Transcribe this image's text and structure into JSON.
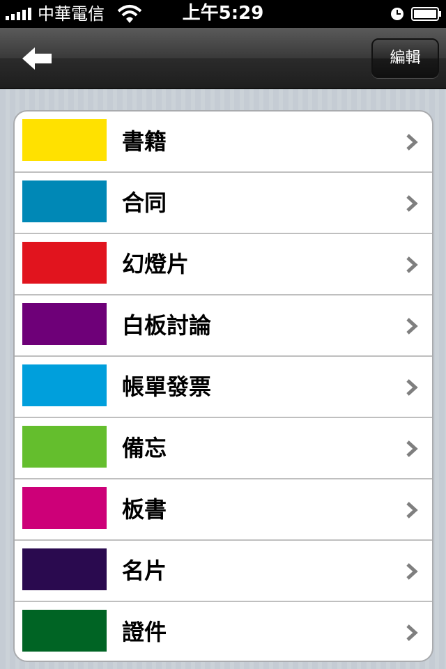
{
  "status_bar": {
    "carrier": "中華電信",
    "time": "上午5:29"
  },
  "nav": {
    "back_icon": "back-arrow-icon",
    "edit_label": "編輯"
  },
  "list": {
    "items": [
      {
        "label": "書籍",
        "color": "#ffe100"
      },
      {
        "label": "合同",
        "color": "#0088b6"
      },
      {
        "label": "幻燈片",
        "color": "#e1141e"
      },
      {
        "label": "白板討論",
        "color": "#6e0078"
      },
      {
        "label": "帳單發票",
        "color": "#009fdc"
      },
      {
        "label": "備忘",
        "color": "#64be2d"
      },
      {
        "label": "板書",
        "color": "#cd0078"
      },
      {
        "label": "名片",
        "color": "#2a0a4f"
      },
      {
        "label": "證件",
        "color": "#006424"
      }
    ]
  }
}
